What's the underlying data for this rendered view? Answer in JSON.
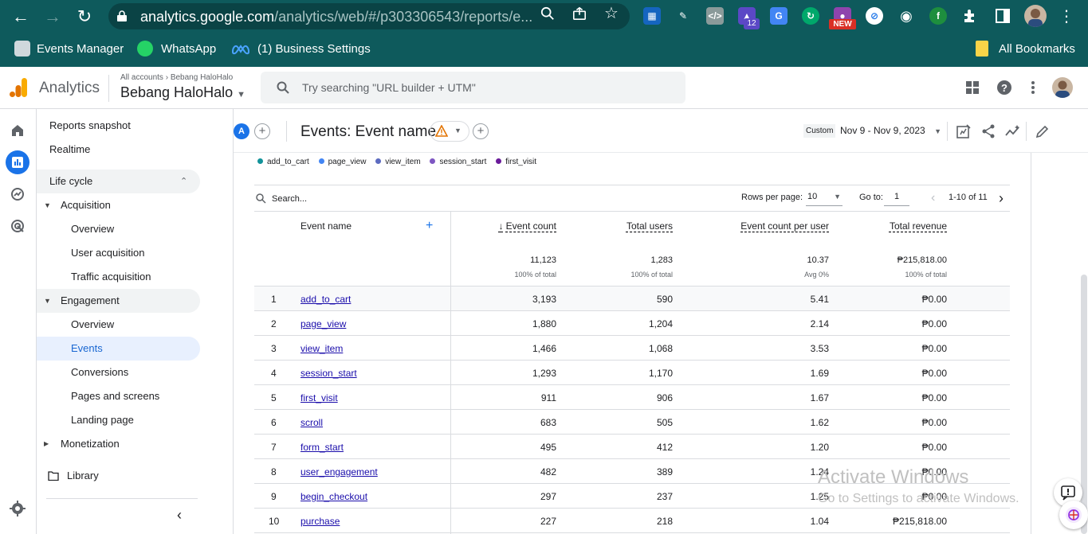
{
  "browser": {
    "url_host": "analytics.google.com",
    "url_path": "/analytics/web/#/p303306543/reports/e...",
    "extension_badge": "12",
    "extension_new": "NEW"
  },
  "bookmarks": [
    {
      "label": "Events Manager"
    },
    {
      "label": "WhatsApp"
    },
    {
      "label": "(1) Business Settings"
    }
  ],
  "bookmarks_folder": "All Bookmarks",
  "header": {
    "app_name": "Analytics",
    "breadcrumb_accounts": "All accounts",
    "breadcrumb_account": "Bebang HaloHalo",
    "property": "Bebang HaloHalo",
    "search_placeholder": "Try searching \"URL builder + UTM\""
  },
  "sidebar": {
    "reports_snapshot": "Reports snapshot",
    "realtime": "Realtime",
    "life_cycle": "Life cycle",
    "acquisition": "Acquisition",
    "acq_items": [
      "Overview",
      "User acquisition",
      "Traffic acquisition"
    ],
    "engagement": "Engagement",
    "eng_items": [
      "Overview",
      "Events",
      "Conversions",
      "Pages and screens",
      "Landing page"
    ],
    "monetization": "Monetization",
    "library": "Library"
  },
  "report": {
    "comparison_chip": "A",
    "title": "Events: Event name",
    "date_tag": "Custom",
    "date_range": "Nov 9 - Nov 9, 2023"
  },
  "legend": [
    {
      "label": "add_to_cart",
      "color": "#12939a"
    },
    {
      "label": "page_view",
      "color": "#4285f4"
    },
    {
      "label": "view_item",
      "color": "#5c6bc0"
    },
    {
      "label": "session_start",
      "color": "#7e57c2"
    },
    {
      "label": "first_visit",
      "color": "#6a1b9a"
    }
  ],
  "table": {
    "search_placeholder": "Search...",
    "rows_per_page_label": "Rows per page:",
    "rows_per_page": "10",
    "goto_label": "Go to:",
    "goto_value": "1",
    "pagination": "1-10 of 11",
    "headers": {
      "event_name": "Event name",
      "event_count": "Event count",
      "total_users": "Total users",
      "per_user": "Event count per user",
      "revenue": "Total revenue"
    },
    "totals": {
      "event_count": "11,123",
      "event_count_sub": "100% of total",
      "total_users": "1,283",
      "total_users_sub": "100% of total",
      "per_user": "10.37",
      "per_user_sub": "Avg 0%",
      "revenue": "₱215,818.00",
      "revenue_sub": "100% of total"
    },
    "rows": [
      {
        "idx": "1",
        "name": "add_to_cart",
        "count": "3,193",
        "users": "590",
        "per_user": "5.41",
        "revenue": "₱0.00"
      },
      {
        "idx": "2",
        "name": "page_view",
        "count": "1,880",
        "users": "1,204",
        "per_user": "2.14",
        "revenue": "₱0.00"
      },
      {
        "idx": "3",
        "name": "view_item",
        "count": "1,466",
        "users": "1,068",
        "per_user": "3.53",
        "revenue": "₱0.00"
      },
      {
        "idx": "4",
        "name": "session_start",
        "count": "1,293",
        "users": "1,170",
        "per_user": "1.69",
        "revenue": "₱0.00"
      },
      {
        "idx": "5",
        "name": "first_visit",
        "count": "911",
        "users": "906",
        "per_user": "1.67",
        "revenue": "₱0.00"
      },
      {
        "idx": "6",
        "name": "scroll",
        "count": "683",
        "users": "505",
        "per_user": "1.62",
        "revenue": "₱0.00"
      },
      {
        "idx": "7",
        "name": "form_start",
        "count": "495",
        "users": "412",
        "per_user": "1.20",
        "revenue": "₱0.00"
      },
      {
        "idx": "8",
        "name": "user_engagement",
        "count": "482",
        "users": "389",
        "per_user": "1.24",
        "revenue": "₱0.00"
      },
      {
        "idx": "9",
        "name": "begin_checkout",
        "count": "297",
        "users": "237",
        "per_user": "1.25",
        "revenue": "₱0.00"
      },
      {
        "idx": "10",
        "name": "purchase",
        "count": "227",
        "users": "218",
        "per_user": "1.04",
        "revenue": "₱215,818.00"
      }
    ]
  },
  "watermark": {
    "line1": "Activate Windows",
    "line2": "Go to Settings to activate Windows."
  }
}
